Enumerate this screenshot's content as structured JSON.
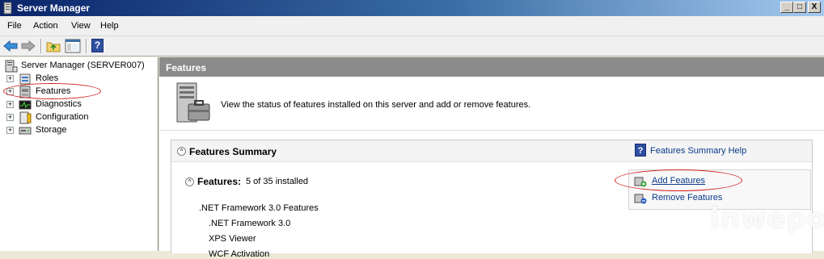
{
  "window": {
    "title": "Server Manager",
    "controls": {
      "minimize": "_",
      "maximize": "□",
      "close": "X"
    }
  },
  "menu": [
    "File",
    "Action",
    "View",
    "Help"
  ],
  "toolbar": {
    "icons": [
      "back-arrow-icon",
      "forward-arrow-icon",
      "up-folder-icon",
      "show-hide-console-tree-icon",
      "help-icon"
    ]
  },
  "tree": {
    "root": "Server Manager (SERVER007)",
    "items": [
      {
        "label": "Roles",
        "expander": "+"
      },
      {
        "label": "Features",
        "expander": "+",
        "highlighted": true
      },
      {
        "label": "Diagnostics",
        "expander": "+"
      },
      {
        "label": "Configuration",
        "expander": "+"
      },
      {
        "label": "Storage",
        "expander": "+"
      }
    ]
  },
  "main": {
    "header": "Features",
    "intro": "View the status of features installed on this server and add or remove features.",
    "summary": {
      "title": "Features Summary",
      "help_link": "Features Summary Help",
      "help_icon_glyph": "?",
      "features_label": "Features:",
      "features_count": "5 of 35 installed",
      "actions": [
        "Add Features",
        "Remove Features"
      ],
      "feature_list": [
        {
          "label": ".NET Framework 3.0 Features",
          "level": 0
        },
        {
          "label": ".NET Framework 3.0",
          "level": 1
        },
        {
          "label": "XPS Viewer",
          "level": 1
        },
        {
          "label": "WCF Activation",
          "level": 1
        }
      ]
    }
  },
  "annotation_color": "#d02020",
  "watermark": "inwepo"
}
